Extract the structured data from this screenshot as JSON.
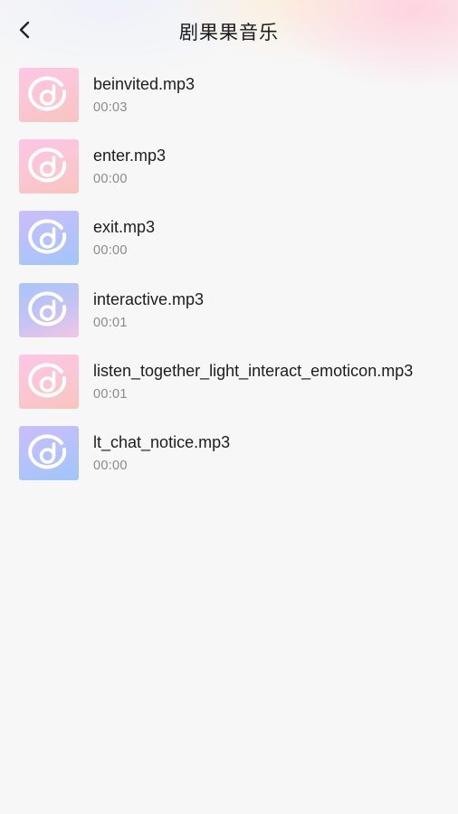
{
  "header": {
    "title": "剧果果音乐",
    "back_icon": "chevron-left-icon"
  },
  "tracks": [
    {
      "name": "beinvited.mp3",
      "duration": "00:03",
      "thumb_style": "pink",
      "icon": "music-note-disc-icon"
    },
    {
      "name": "enter.mp3",
      "duration": "00:00",
      "thumb_style": "pink",
      "icon": "music-note-disc-icon"
    },
    {
      "name": "exit.mp3",
      "duration": "00:00",
      "thumb_style": "blue",
      "icon": "music-note-disc-icon"
    },
    {
      "name": "interactive.mp3",
      "duration": "00:01",
      "thumb_style": "blue2",
      "icon": "music-note-disc-icon"
    },
    {
      "name": "listen_together_light_interact_emoticon.mp3",
      "duration": "00:01",
      "thumb_style": "pink",
      "icon": "music-note-disc-icon"
    },
    {
      "name": "lt_chat_notice.mp3",
      "duration": "00:00",
      "thumb_style": "blue",
      "icon": "music-note-disc-icon"
    }
  ],
  "colors": {
    "background": "#f7f7f7",
    "title_text": "#1a1a1a",
    "secondary_text": "#8a8a8a"
  }
}
